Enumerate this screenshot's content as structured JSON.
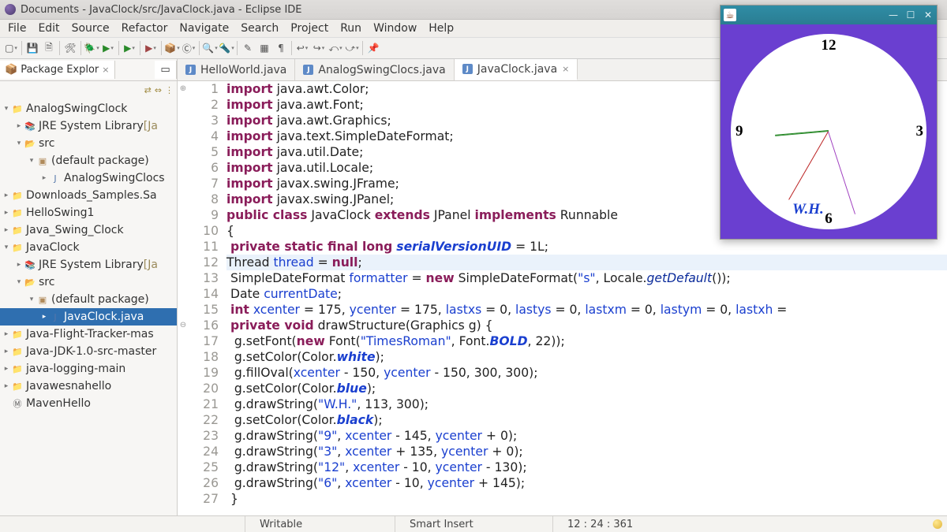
{
  "titlebar": {
    "text": "Documents - JavaClock/src/JavaClock.java - Eclipse IDE"
  },
  "menubar": [
    "File",
    "Edit",
    "Source",
    "Refactor",
    "Navigate",
    "Search",
    "Project",
    "Run",
    "Window",
    "Help"
  ],
  "sidebar": {
    "view_tab": {
      "label": "Package Explor",
      "close": "×"
    },
    "tree": [
      {
        "depth": 0,
        "tw": "▾",
        "icon": "prj",
        "label": "AnalogSwingClock"
      },
      {
        "depth": 1,
        "tw": "▸",
        "icon": "lib",
        "label": "JRE System Library ",
        "trail": "[Ja"
      },
      {
        "depth": 1,
        "tw": "▾",
        "icon": "fld",
        "label": "src"
      },
      {
        "depth": 2,
        "tw": "▾",
        "icon": "pkg",
        "label": "(default package)"
      },
      {
        "depth": 3,
        "tw": "▸",
        "icon": "jfile",
        "label": "AnalogSwingClocs"
      },
      {
        "depth": 0,
        "tw": "▸",
        "icon": "prj",
        "label": "Downloads_Samples.Sa"
      },
      {
        "depth": 0,
        "tw": "▸",
        "icon": "prj",
        "label": "HelloSwing1"
      },
      {
        "depth": 0,
        "tw": "▸",
        "icon": "prj",
        "label": "Java_Swing_Clock"
      },
      {
        "depth": 0,
        "tw": "▾",
        "icon": "prj",
        "label": "JavaClock"
      },
      {
        "depth": 1,
        "tw": "▸",
        "icon": "lib",
        "label": "JRE System Library ",
        "trail": "[Ja"
      },
      {
        "depth": 1,
        "tw": "▾",
        "icon": "fld",
        "label": "src"
      },
      {
        "depth": 2,
        "tw": "▾",
        "icon": "pkg",
        "label": "(default package)"
      },
      {
        "depth": 3,
        "tw": "▸",
        "icon": "jfile",
        "label": "JavaClock.java",
        "sel": true
      },
      {
        "depth": 0,
        "tw": "▸",
        "icon": "prj",
        "label": "Java-Flight-Tracker-mas"
      },
      {
        "depth": 0,
        "tw": "▸",
        "icon": "prj",
        "label": "Java-JDK-1.0-src-master"
      },
      {
        "depth": 0,
        "tw": "▸",
        "icon": "prj",
        "label": "java-logging-main"
      },
      {
        "depth": 0,
        "tw": "▸",
        "icon": "prj",
        "label": "Javawesnahello"
      },
      {
        "depth": 0,
        "tw": " ",
        "icon": "mvn",
        "label": "MavenHello"
      }
    ]
  },
  "editor": {
    "tabs": [
      {
        "label": "HelloWorld.java"
      },
      {
        "label": "AnalogSwingClocs.java"
      },
      {
        "label": "JavaClock.java",
        "active": true
      }
    ],
    "start_line": 1,
    "lines": [
      {
        "mark": "⊕",
        "tokens": [
          [
            "kw",
            "import"
          ],
          [
            "",
            " java.awt.Color;"
          ]
        ]
      },
      {
        "tokens": [
          [
            "kw",
            "import"
          ],
          [
            "",
            " java.awt.Font;"
          ]
        ]
      },
      {
        "tokens": [
          [
            "kw",
            "import"
          ],
          [
            "",
            " java.awt.Graphics;"
          ]
        ]
      },
      {
        "tokens": [
          [
            "kw",
            "import"
          ],
          [
            "",
            " java.text.SimpleDateFormat;"
          ]
        ]
      },
      {
        "tokens": [
          [
            "kw",
            "import"
          ],
          [
            "",
            " java.util.Date;"
          ]
        ]
      },
      {
        "tokens": [
          [
            "kw",
            "import"
          ],
          [
            "",
            " java.util.Locale;"
          ]
        ]
      },
      {
        "tokens": [
          [
            "kw",
            "import"
          ],
          [
            "",
            " javax.swing.JFrame;"
          ]
        ]
      },
      {
        "tokens": [
          [
            "kw",
            "import"
          ],
          [
            "",
            " javax.swing.JPanel;"
          ]
        ]
      },
      {
        "tokens": [
          [
            "kw",
            "public class"
          ],
          [
            "",
            " JavaClock "
          ],
          [
            "kw",
            "extends"
          ],
          [
            "",
            " JPanel "
          ],
          [
            "kw",
            "implements"
          ],
          [
            "",
            " Runnable"
          ]
        ]
      },
      {
        "tokens": [
          [
            "",
            "{"
          ]
        ]
      },
      {
        "tokens": [
          [
            "",
            " "
          ],
          [
            "kw",
            "private static final long"
          ],
          [
            "",
            " "
          ],
          [
            "stat",
            "serialVersionUID"
          ],
          [
            "",
            " = 1L;"
          ]
        ]
      },
      {
        "hl": true,
        "tokens": [
          [
            "",
            "Thread "
          ],
          [
            "fld",
            "thread"
          ],
          [
            "",
            " = "
          ],
          [
            "kw",
            "null"
          ],
          [
            "",
            ";"
          ]
        ]
      },
      {
        "tokens": [
          [
            "",
            " SimpleDateFormat "
          ],
          [
            "fld",
            "formatter"
          ],
          [
            "",
            " = "
          ],
          [
            "kw",
            "new"
          ],
          [
            "",
            " SimpleDateFormat("
          ],
          [
            "str",
            "\"s\""
          ],
          [
            "",
            ", Locale."
          ],
          [
            "staticfield",
            "getDefault"
          ],
          [
            "",
            "());"
          ]
        ]
      },
      {
        "tokens": [
          [
            "",
            " Date "
          ],
          [
            "fld",
            "currentDate"
          ],
          [
            "",
            ";"
          ]
        ]
      },
      {
        "tokens": [
          [
            "",
            " "
          ],
          [
            "kw",
            "int"
          ],
          [
            "",
            " "
          ],
          [
            "fld",
            "xcenter"
          ],
          [
            "",
            " = 175, "
          ],
          [
            "fld",
            "ycenter"
          ],
          [
            "",
            " = 175, "
          ],
          [
            "fld",
            "lastxs"
          ],
          [
            "",
            " = 0, "
          ],
          [
            "fld",
            "lastys"
          ],
          [
            "",
            " = 0, "
          ],
          [
            "fld",
            "lastxm"
          ],
          [
            "",
            " = 0, "
          ],
          [
            "fld",
            "lastym"
          ],
          [
            "",
            " = 0, "
          ],
          [
            "fld",
            "lastxh"
          ],
          [
            "",
            " ="
          ]
        ]
      },
      {
        "mark": "⊖",
        "tokens": [
          [
            "",
            " "
          ],
          [
            "kw",
            "private void"
          ],
          [
            "",
            " drawStructure(Graphics g) {"
          ]
        ]
      },
      {
        "tokens": [
          [
            "",
            "  g.setFont("
          ],
          [
            "kw",
            "new"
          ],
          [
            "",
            " Font("
          ],
          [
            "str",
            "\"TimesRoman\""
          ],
          [
            "",
            ", Font."
          ],
          [
            "stat",
            "BOLD"
          ],
          [
            "",
            ", 22));"
          ]
        ]
      },
      {
        "tokens": [
          [
            "",
            "  g.setColor(Color."
          ],
          [
            "stat",
            "white"
          ],
          [
            "",
            ");"
          ]
        ]
      },
      {
        "tokens": [
          [
            "",
            "  g.fillOval("
          ],
          [
            "fld",
            "xcenter"
          ],
          [
            "",
            " - 150, "
          ],
          [
            "fld",
            "ycenter"
          ],
          [
            "",
            " - 150, 300, 300);"
          ]
        ]
      },
      {
        "tokens": [
          [
            "",
            "  g.setColor(Color."
          ],
          [
            "stat",
            "blue"
          ],
          [
            "",
            ");"
          ]
        ]
      },
      {
        "tokens": [
          [
            "",
            "  g.drawString("
          ],
          [
            "str",
            "\"W.H.\""
          ],
          [
            "",
            ", 113, 300);"
          ]
        ]
      },
      {
        "tokens": [
          [
            "",
            "  g.setColor(Color."
          ],
          [
            "stat",
            "black"
          ],
          [
            "",
            ");"
          ]
        ]
      },
      {
        "tokens": [
          [
            "",
            "  g.drawString("
          ],
          [
            "str",
            "\"9\""
          ],
          [
            "",
            ", "
          ],
          [
            "fld",
            "xcenter"
          ],
          [
            "",
            " - 145, "
          ],
          [
            "fld",
            "ycenter"
          ],
          [
            "",
            " + 0);"
          ]
        ]
      },
      {
        "tokens": [
          [
            "",
            "  g.drawString("
          ],
          [
            "str",
            "\"3\""
          ],
          [
            "",
            ", "
          ],
          [
            "fld",
            "xcenter"
          ],
          [
            "",
            " + 135, "
          ],
          [
            "fld",
            "ycenter"
          ],
          [
            "",
            " + 0);"
          ]
        ]
      },
      {
        "tokens": [
          [
            "",
            "  g.drawString("
          ],
          [
            "str",
            "\"12\""
          ],
          [
            "",
            ", "
          ],
          [
            "fld",
            "xcenter"
          ],
          [
            "",
            " - 10, "
          ],
          [
            "fld",
            "ycenter"
          ],
          [
            "",
            " - 130);"
          ]
        ]
      },
      {
        "tokens": [
          [
            "",
            "  g.drawString("
          ],
          [
            "str",
            "\"6\""
          ],
          [
            "",
            ", "
          ],
          [
            "fld",
            "xcenter"
          ],
          [
            "",
            " - 10, "
          ],
          [
            "fld",
            "ycenter"
          ],
          [
            "",
            " + 145);"
          ]
        ]
      },
      {
        "tokens": [
          [
            "",
            " }"
          ]
        ]
      }
    ]
  },
  "status": {
    "writable": "Writable",
    "insert": "Smart Insert",
    "pos": "12 : 24 : 361"
  },
  "clock": {
    "n12": "12",
    "n3": "3",
    "n6": "6",
    "n9": "9",
    "wh": "W.H."
  }
}
